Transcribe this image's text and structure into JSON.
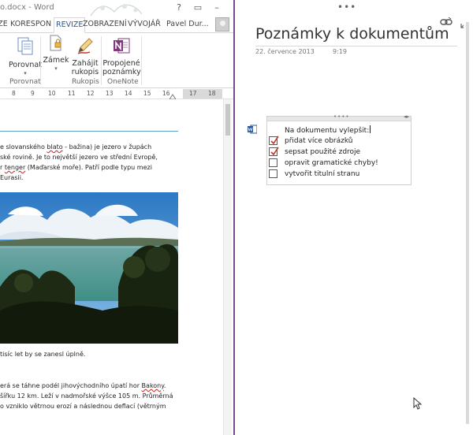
{
  "word": {
    "title": "o.docx - Word",
    "window_buttons": [
      "?",
      "▭",
      "–"
    ],
    "tabs": [
      "EVIZE",
      "KORESPON",
      "REVIZE",
      "ZOBRAZENÍ",
      "VÝVOJÁŘ",
      "Pavel Dur..."
    ],
    "active_tab": "REVIZE",
    "ribbon": {
      "compare": {
        "label1": "Porovnat",
        "arrow": "▾"
      },
      "lock": {
        "label1": "Zámek",
        "arrow": "▾"
      },
      "ink": {
        "label1": "Zahájit",
        "label2": "rukopis"
      },
      "linked": {
        "label1": "Propojené",
        "label2": "poznámky"
      },
      "groups": [
        "Porovnat",
        "Rukopis",
        "OneNote"
      ]
    },
    "ruler": [
      "8",
      "9",
      "10",
      "11",
      "12",
      "13",
      "14",
      "15",
      "16",
      "17",
      "18"
    ],
    "doc": {
      "line1_a": "e slovanského ",
      "line1_b": "blato",
      "line1_c": " - bažina) je jezero v župách",
      "line2": "ské rovině. Je to největší jezero ve střední Evropě,",
      "line3_a": "r ",
      "line3_b": "tenger",
      "line3_c": " (Maďarské moře). Patří podle typu mezi",
      "line4": " Eurasii.",
      "line5": "tisíc let by se zanesl úplně.",
      "line6_a": "erá se táhne podél jihovýchodního úpatí hor ",
      "line6_b": "Bakony",
      "line6_c": ".",
      "line7": " šířku 12 km. Leží v nadmořské výšce 105 m. Průměrná",
      "line8": "o vzniklo větrnou erozí a následnou deflací (větrným"
    }
  },
  "onenote": {
    "top_dots": "•••",
    "title": "Poznámky k dokumentům",
    "date": "22. července 2013",
    "time": "9:19",
    "note": {
      "heading": "Na dokumentu vylepšit:",
      "items": [
        {
          "text": "přidat více obrázků",
          "checked": true
        },
        {
          "text": "sepsat použité zdroje",
          "checked": true
        },
        {
          "text": "opravit gramatické chyby!",
          "checked": false
        },
        {
          "text": "vytvořit titulní stranu",
          "checked": false
        }
      ]
    },
    "colors": {
      "accent": "#7b4a8c",
      "onenote": "#80397b",
      "word": "#2b579a"
    }
  }
}
